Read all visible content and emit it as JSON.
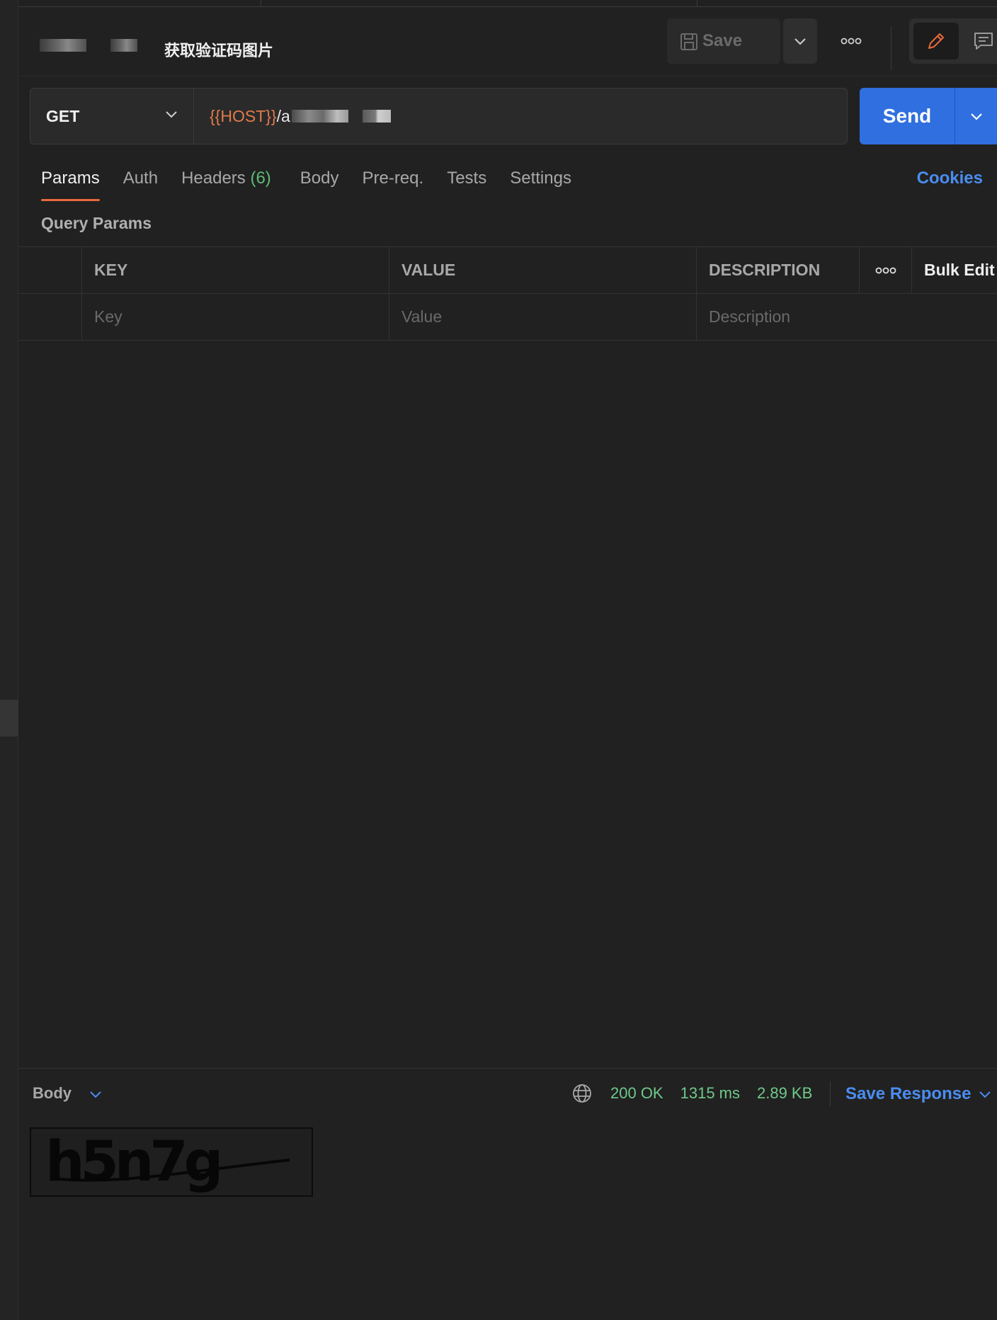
{
  "header": {
    "title": "获取验证码图片",
    "save_label": "Save"
  },
  "request": {
    "method": "GET",
    "url_var": "{{HOST}}",
    "url_path": "/a"
  },
  "send_label": "Send",
  "tabs": [
    {
      "label": "Params",
      "active": true
    },
    {
      "label": "Auth"
    },
    {
      "label": "Headers ",
      "count": "(6)"
    },
    {
      "label": "Body"
    },
    {
      "label": "Pre-req."
    },
    {
      "label": "Tests"
    },
    {
      "label": "Settings"
    }
  ],
  "cookies_label": "Cookies",
  "query_params": {
    "title": "Query Params",
    "columns": [
      "KEY",
      "VALUE",
      "DESCRIPTION"
    ],
    "bulk_edit": "Bulk Edit",
    "placeholders": {
      "key": "Key",
      "value": "Value",
      "description": "Description"
    }
  },
  "response": {
    "body_label": "Body",
    "status": "200 OK",
    "time": "1315 ms",
    "size": "2.89 KB",
    "save_response": "Save Response",
    "captcha_text": "h5n7g"
  },
  "colors": {
    "accent": "#e8693c",
    "send": "#2f6fdf",
    "link": "#4a8df0",
    "success": "#6fc98a"
  }
}
